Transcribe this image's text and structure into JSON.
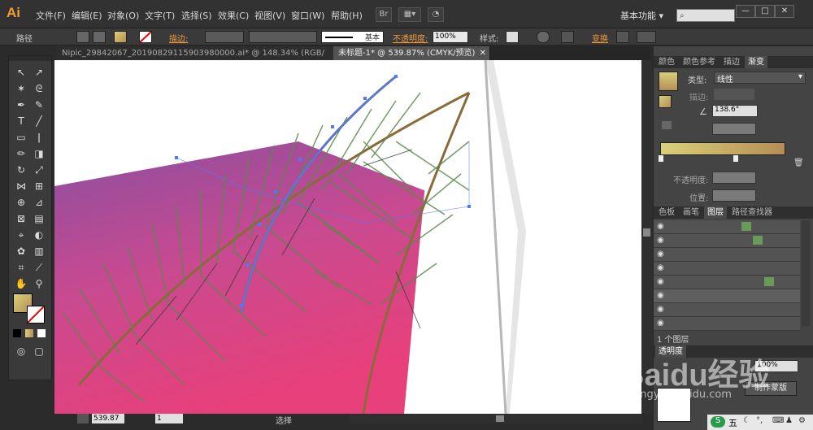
{
  "app": {
    "logo": "Ai"
  },
  "menu": [
    "文件(F)",
    "编辑(E)",
    "对象(O)",
    "文字(T)",
    "选择(S)",
    "效果(C)",
    "视图(V)",
    "窗口(W)",
    "帮助(H)"
  ],
  "workspace": "基本功能",
  "control_bar": {
    "selection_label": "路径",
    "stroke_label": "描边:",
    "stroke_style": "基本",
    "opacity_label": "不透明度:",
    "opacity_value": "100%",
    "style_label": "样式:",
    "transform_label": "变换"
  },
  "tabs": [
    {
      "label": "Nipic_29842067_20190829115903980000.ai* @ 148.34% (RGB/预览)",
      "active": false
    },
    {
      "label": "未标题-1* @ 539.87% (CMYK/预览)",
      "active": true
    }
  ],
  "status": {
    "zoom": "539.87",
    "artboard": "1",
    "tool": "选择"
  },
  "gradient_panel": {
    "tabs": [
      "颜色",
      "颜色参考",
      "描边",
      "渐变"
    ],
    "type_label": "类型:",
    "type_value": "线性",
    "stroke_label": "描边:",
    "angle_value": "138.6°",
    "opacity_label": "不透明度:",
    "position_label": "位置:",
    "start_color": "#d9d07a",
    "end_color": "#b58d55"
  },
  "layers_panel": {
    "tabs": [
      "色板",
      "画笔",
      "图层",
      "路径查找器"
    ],
    "footer": "1 个图层"
  },
  "transparency_panel": {
    "tab": "透明度",
    "opacity_value": "100%",
    "make_mask_button": "制作蒙版"
  },
  "watermark": {
    "brand": "Baidu经验",
    "url": "jingyan.baidu.com"
  },
  "taskbar": {
    "ime": "五"
  },
  "colors": {
    "pink": "#e8407a",
    "purple": "#8a4fa0",
    "leaf_green": "#5a8a4a",
    "stem_brown": "#8a6a3a",
    "selection_blue": "#4a7aff"
  }
}
